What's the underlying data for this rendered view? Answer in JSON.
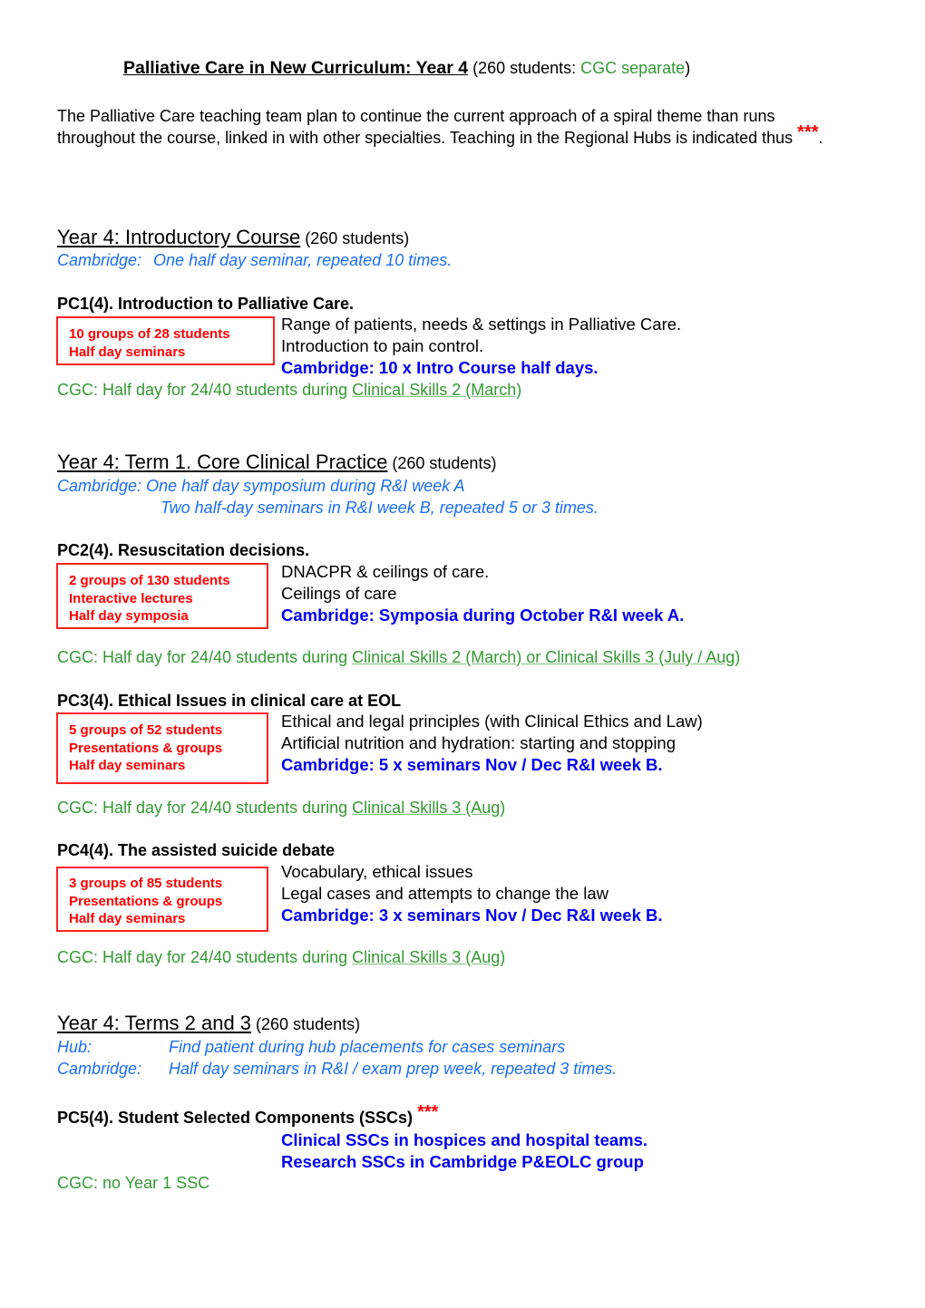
{
  "title": {
    "main": "Palliative Care in New Curriculum: Year 4",
    "sub_open": " (260 students: ",
    "sub_cgc": "CGC separate",
    "sub_close": ")"
  },
  "intro": {
    "text": "The Palliative Care teaching team plan to continue the current approach of a spiral theme than runs throughout the course, linked in with other specialties. Teaching in the Regional Hubs is indicated thus ",
    "stars": "***",
    "end": "."
  },
  "sections": [
    {
      "heading": "Year 4: Introductory Course",
      "count": " (260 students)",
      "notes": [
        {
          "label": "Cambridge:",
          "text": "One half day seminar, repeated 10 times."
        }
      ]
    },
    {
      "heading": "Year 4: Term 1. Core Clinical Practice",
      "count": " (260 students)",
      "notes": [
        {
          "label": "Cambridge:",
          "text": "One half day symposium during R&I week A"
        },
        {
          "label": "",
          "text": "Two half-day seminars in R&I week B, repeated 5 or 3 times."
        }
      ]
    },
    {
      "heading": "Year 4: Terms 2 and 3",
      "count": " (260 students)",
      "notes": [
        {
          "label": "Hub:",
          "text": "Find patient during hub placements for cases seminars"
        },
        {
          "label": "Cambridge:",
          "text": "Half day seminars in R&I / exam prep week, repeated 3 times."
        }
      ]
    }
  ],
  "modules": [
    {
      "heading": "PC1(4). Introduction to Palliative Care.",
      "box": [
        "10 groups of 28 students",
        "Half day seminars"
      ],
      "desc": [
        "Range of patients, needs & settings in Palliative Care.",
        "Introduction to pain control."
      ],
      "cambridge": "Cambridge: 10 x Intro Course half days.",
      "cgc_prefix": "CGC: Half day for 24/40 students during ",
      "cgc_link": "Clinical Skills 2 (March)"
    },
    {
      "heading": "PC2(4). Resuscitation decisions.",
      "box": [
        "2 groups of 130 students",
        "Interactive lectures",
        "Half day symposia"
      ],
      "desc": [
        "DNACPR & ceilings of care.",
        "Ceilings of care"
      ],
      "cambridge": "Cambridge: Symposia during October R&I week A.",
      "cgc_prefix": "CGC: Half day for 24/40 students during ",
      "cgc_link": "Clinical Skills 2 (March) or Clinical Skills 3 (July / Aug)"
    },
    {
      "heading": "PC3(4). Ethical Issues in clinical care at EOL",
      "box": [
        "5 groups of 52 students",
        "Presentations & groups",
        "Half day seminars"
      ],
      "desc": [
        "Ethical and legal principles (with Clinical Ethics and Law)",
        "Artificial nutrition and hydration: starting and stopping"
      ],
      "cambridge": "Cambridge: 5 x seminars Nov / Dec R&I week B.",
      "cgc_prefix": "CGC: Half day for 24/40 students during ",
      "cgc_link": "Clinical Skills 3 (Aug)"
    },
    {
      "heading": "PC4(4). The assisted suicide debate",
      "box": [
        "3 groups of 85 students",
        "Presentations & groups",
        "Half day seminars"
      ],
      "desc": [
        "Vocabulary, ethical issues",
        "Legal cases and attempts to change the law"
      ],
      "cambridge": "Cambridge: 3 x seminars Nov / Dec R&I week B.",
      "cgc_prefix": "CGC: Half day for 24/40 students during ",
      "cgc_link": "Clinical Skills 3 (Aug)"
    },
    {
      "heading": "PC5(4). Student Selected Components (SSCs) ",
      "stars": "***",
      "cambridge_lines": [
        "Clinical SSCs in hospices and hospital teams.",
        "Research SSCs in Cambridge P&EOLC group"
      ],
      "cgc": "CGC: no Year 1 SSC"
    }
  ]
}
